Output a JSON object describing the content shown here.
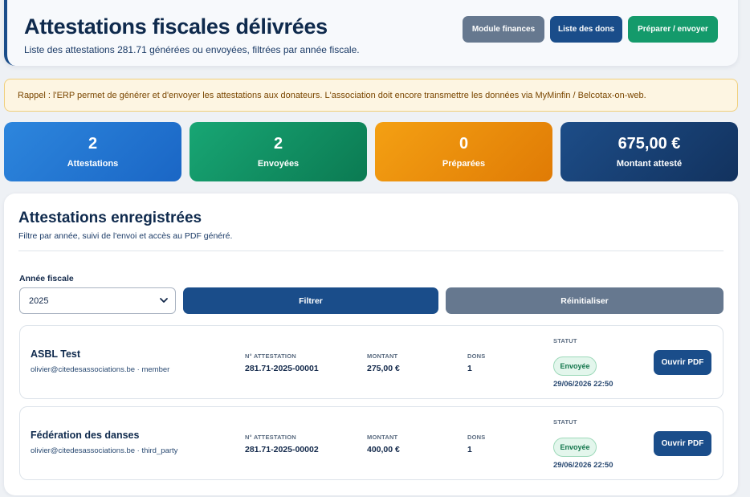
{
  "header": {
    "title": "Attestations fiscales délivrées",
    "subtitle": "Liste des attestations 281.71 générées ou envoyées, filtrées par année fiscale.",
    "buttons": {
      "finances": "Module finances",
      "donations": "Liste des dons",
      "prepare": "Préparer / envoyer"
    }
  },
  "notice": "Rappel : l'ERP permet de générer et d'envoyer les attestations aux donateurs. L'association doit encore transmettre les données via MyMinfin / Belcotax-on-web.",
  "stats": [
    {
      "value": "2",
      "label": "Attestations"
    },
    {
      "value": "2",
      "label": "Envoyées"
    },
    {
      "value": "0",
      "label": "Préparées"
    },
    {
      "value": "675,00 €",
      "label": "Montant attesté"
    }
  ],
  "section": {
    "title": "Attestations enregistrées",
    "subtitle": "Filtre par année, suivi de l'envoi et accès au PDF généré."
  },
  "filter": {
    "year_label": "Année fiscale",
    "year_value": "2025",
    "filter_label": "Filtrer",
    "reset_label": "Réinitialiser"
  },
  "columns": {
    "number": "N° ATTESTATION",
    "amount": "MONTANT",
    "donations": "DONS",
    "status": "STATUT"
  },
  "rows": [
    {
      "name": "ASBL Test",
      "email": "olivier@citedesassociations.be · member",
      "number": "281.71-2025-00001",
      "amount": "275,00 €",
      "donations": "1",
      "status": "Envoyée",
      "date": "29/06/2026 22:50",
      "pdf_label": "Ouvrir PDF"
    },
    {
      "name": "Fédération des danses",
      "email": "olivier@citedesassociations.be · third_party",
      "number": "281.71-2025-00002",
      "amount": "400,00 €",
      "donations": "1",
      "status": "Envoyée",
      "date": "29/06/2026 22:50",
      "pdf_label": "Ouvrir PDF"
    }
  ]
}
